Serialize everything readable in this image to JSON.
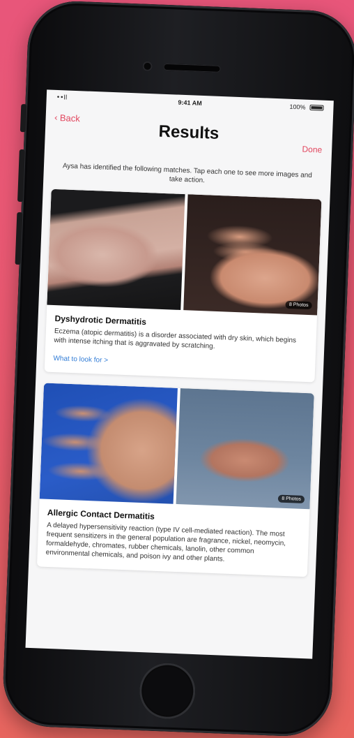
{
  "status_bar": {
    "signal": "••ll ",
    "time": "9:41 AM",
    "battery": "100%"
  },
  "nav": {
    "back_label": "Back",
    "title": "Results",
    "done_label": "Done"
  },
  "subtitle": "Aysa has identified the following matches. Tap each one to see more images and take action.",
  "results": [
    {
      "title": "Dyshydrotic Dermatitis",
      "description": "Eczema (atopic dermatitis) is a disorder associated with dry skin, which begins with intense itching that is aggravated by scratching.",
      "link": "What to look for >",
      "tag": "8 Photos"
    },
    {
      "title": "Allergic Contact Dermatitis",
      "description": "A delayed hypersensitivity reaction (type IV cell-mediated reaction). The most frequent sensitizers in the general population are fragrance, nickel, neomycin, formaldehyde, chromates, rubber chemicals, lanolin, other common environmental chemicals, and poison ivy and other plants.",
      "tag": "8 Photos"
    }
  ]
}
